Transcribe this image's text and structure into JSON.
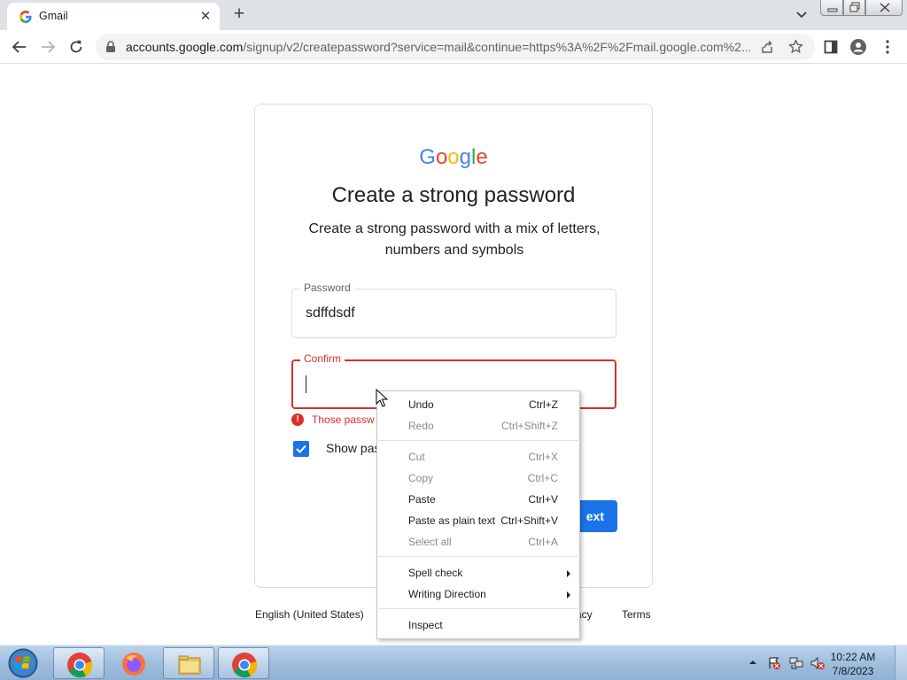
{
  "browser": {
    "tab_title": "Gmail",
    "tab_close": "✕",
    "new_tab": "+",
    "url_main": "accounts.google.com",
    "url_rest": "/signup/v2/createpassword?service=mail&continue=https%3A%2F%2Fmail.google.com%2...",
    "icons": [
      "back-icon",
      "forward-icon",
      "reload-icon",
      "lock-icon",
      "share-icon",
      "star-icon",
      "sidepanel-icon",
      "profile-icon",
      "menu-icon"
    ]
  },
  "page": {
    "logo_letters": [
      "G",
      "o",
      "o",
      "g",
      "l",
      "e"
    ],
    "logo_colors": [
      "#4285F4",
      "#EA4335",
      "#FBBC05",
      "#4285F4",
      "#34A853",
      "#EA4335"
    ],
    "heading": "Create a strong password",
    "subheading": "Create a strong password with a mix of letters, numbers and symbols",
    "password_label": "Password",
    "password_value": "sdffdsdf",
    "confirm_label": "Confirm",
    "confirm_value": "",
    "error_icon": "!",
    "error_text": "Those passw",
    "show_password_label": "Show pas",
    "show_password_checked": true,
    "next_label": "ext",
    "accent_color": "#1a73e8",
    "error_color": "#d93025"
  },
  "footer": {
    "language": "English (United States)",
    "privacy": "acy",
    "terms": "Terms"
  },
  "context_menu": {
    "items": [
      {
        "label": "Undo",
        "shortcut": "Ctrl+Z",
        "enabled": true
      },
      {
        "label": "Redo",
        "shortcut": "Ctrl+Shift+Z",
        "enabled": false
      },
      {
        "label": "Cut",
        "shortcut": "Ctrl+X",
        "enabled": false
      },
      {
        "label": "Copy",
        "shortcut": "Ctrl+C",
        "enabled": false
      },
      {
        "label": "Paste",
        "shortcut": "Ctrl+V",
        "enabled": true
      },
      {
        "label": "Paste as plain text",
        "shortcut": "Ctrl+Shift+V",
        "enabled": true
      },
      {
        "label": "Select all",
        "shortcut": "Ctrl+A",
        "enabled": false
      },
      {
        "label": "Spell check",
        "shortcut": "",
        "enabled": true,
        "submenu": true
      },
      {
        "label": "Writing Direction",
        "shortcut": "",
        "enabled": true,
        "submenu": true
      },
      {
        "label": "Inspect",
        "shortcut": "",
        "enabled": true
      }
    ]
  },
  "taskbar": {
    "apps": [
      "chrome-icon",
      "firefox-icon",
      "file-explorer-icon",
      "chrome-icon"
    ],
    "time": "10:22 AM",
    "date": "7/8/2023"
  }
}
